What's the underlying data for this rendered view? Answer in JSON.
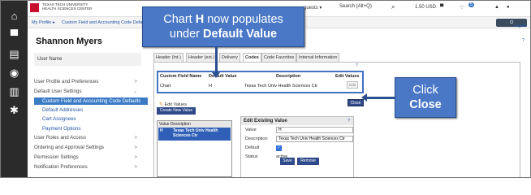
{
  "topbar": {
    "logo_line1": "TEXAS TECH UNIVERSITY",
    "logo_line2": "HEALTH SCIENCES CENTER",
    "requests_menu": "quests ▾",
    "search_placeholder": "Search (Alt+Q)",
    "cart_total": "1.50 USD",
    "notification_count": "5"
  },
  "breadcrumb": {
    "item1": "My Profile ▸",
    "item2": "Custom Field and Accounting Code Defaults",
    "logout_label": "Logout"
  },
  "sidebar": {
    "user_name": "Shannon Myers",
    "user_name_label": "User Name",
    "items": [
      {
        "label": "User Profile and Preferences",
        "chev": ">"
      },
      {
        "label": "Default User Settings",
        "chev": "⌄"
      },
      {
        "label": "Custom Field and Accounting Code Defaults"
      },
      {
        "label": "Default Addresses"
      },
      {
        "label": "Cart Assignees"
      },
      {
        "label": "Payment Options"
      },
      {
        "label": "User Roles and Access",
        "chev": ">"
      },
      {
        "label": "Ordering and Approval Settings",
        "chev": ">"
      },
      {
        "label": "Permission Settings",
        "chev": ">"
      },
      {
        "label": "Notification Preferences",
        "chev": ">"
      }
    ]
  },
  "tabs": [
    "Header (Int.)",
    "Header (ext.)",
    "Delivery",
    "Codes",
    "Code Favorites",
    "Internal Information"
  ],
  "grid": {
    "headers": [
      "Custom Field Name",
      "Default Value",
      "Description",
      "Edit Values"
    ],
    "row": {
      "name": "Chart",
      "value": "H",
      "description": "Texas Tech Univ Health Sciences Ctr",
      "edit": "Edit"
    },
    "close_label": "Close"
  },
  "edit_values_label": "Edit Values",
  "create_new_value_label": "Create New Value",
  "value_list": {
    "header_value": "Value",
    "header_desc": "Description",
    "row_value": "H",
    "row_desc": "Texas Tech Univ Health Sciences Ctr"
  },
  "edit_existing": {
    "title": "Edit Existing Value",
    "help": "?",
    "value_label": "Value",
    "value": "H",
    "description_label": "Description",
    "description": "Texas Tech Univ Health Sciences Ctr",
    "default_label": "Default",
    "default_checked": "✓",
    "status_label": "Status",
    "status": "active",
    "save_label": "Save",
    "remove_label": "Remove"
  },
  "callouts": {
    "top_line1a": "Chart ",
    "top_line1b": "H",
    "top_line1c": " now populates",
    "top_line2a": "under ",
    "top_line2b": "Default Value",
    "right_line1": "Click",
    "right_line2": "Close"
  },
  "colors": {
    "accent": "#4a78c6",
    "nav_active": "#3a7bc6",
    "rail": "#2b2b2b"
  }
}
